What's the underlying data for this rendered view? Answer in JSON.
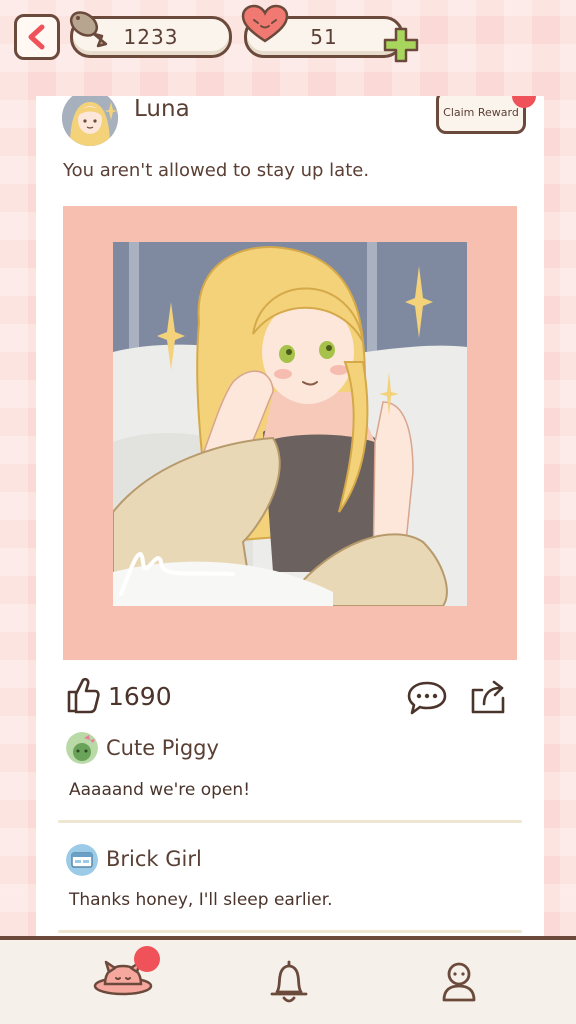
{
  "header": {
    "fish_count": "1233",
    "heart_count": "51"
  },
  "post": {
    "author": "Luna",
    "claim_label": "Claim Reward",
    "text": "You aren't allowed to stay up late.",
    "likes": "1690"
  },
  "comments": [
    {
      "name": "Cute Piggy",
      "text": "Aaaaand we're open!"
    },
    {
      "name": "Brick Girl",
      "text": "Thanks honey, I'll sleep earlier."
    }
  ],
  "icons": {
    "back": "back-arrow-icon",
    "fish": "fish-icon",
    "heart": "heart-icon",
    "plus": "plus-icon",
    "like": "thumbs-up-icon",
    "comment": "speech-bubble-icon",
    "share": "share-icon",
    "home": "planet-cat-icon",
    "bell": "bell-icon",
    "profile": "profile-icon"
  },
  "colors": {
    "background": "#fbd9d6",
    "outline": "#6b4a3c",
    "notification": "#f0525a",
    "photo_frame": "#f6bfb0",
    "plus": "#a8d65c"
  }
}
